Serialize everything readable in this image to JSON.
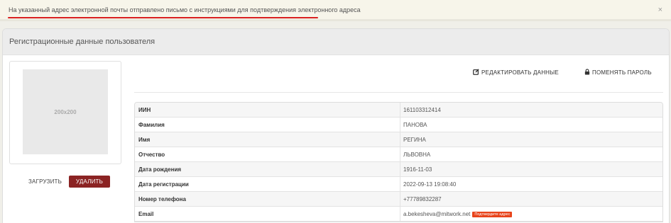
{
  "alert": {
    "message": "На указанный адрес электронной почты отправлено письмо с инструкциями для подтверждения электронного адреса",
    "close_glyph": "×"
  },
  "panel": {
    "title": "Регистрационные данные пользователя"
  },
  "avatar": {
    "placeholder": "200x200",
    "upload_label": "ЗАГРУЗИТЬ",
    "delete_label": "УДАЛИТЬ"
  },
  "actions": {
    "edit_label": "РЕДАКТИРОВАТЬ ДАННЫЕ",
    "edit_icon": "edit-icon",
    "password_label": "ПОМЕНЯТЬ ПАРОЛЬ",
    "password_icon": "lock-icon"
  },
  "rows": [
    {
      "label": "ИИН",
      "value": "161103312414"
    },
    {
      "label": "Фамилия",
      "value": "ПАНОВА"
    },
    {
      "label": "Имя",
      "value": "РЕГИНА"
    },
    {
      "label": "Отчество",
      "value": "ЛЬВОВНА"
    },
    {
      "label": "Дата рождения",
      "value": "1916-11-03"
    },
    {
      "label": "Дата регистрации",
      "value": "2022-09-13 19:08:40"
    },
    {
      "label": "Номер телефона",
      "value": "+77789832287"
    },
    {
      "label": "Email",
      "value": "a.bekesheva@mitwork.net",
      "badge": "Подтвердите адрес"
    }
  ],
  "colors": {
    "delete_button": "#8b2323",
    "badge": "#e8431a",
    "alert_underline": "#d92020"
  }
}
